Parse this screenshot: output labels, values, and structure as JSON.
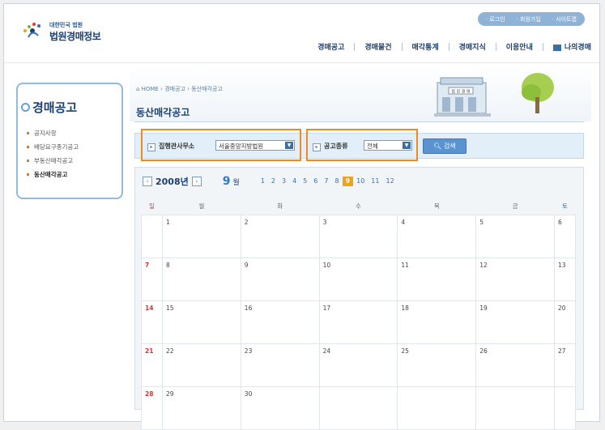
{
  "header": {
    "logo_small": "대한민국 법원",
    "logo_big": "법원경매정보",
    "util_links": [
      "로그인",
      "회원가입",
      "사이트맵"
    ],
    "nav": [
      "경매공고",
      "경매물건",
      "매각통계",
      "경매지식",
      "이용안내",
      "나의경매"
    ]
  },
  "sidebar": {
    "title": "경매공고",
    "items": [
      {
        "label": "공지사항",
        "active": false
      },
      {
        "label": "배당요구종기공고",
        "active": false
      },
      {
        "label": "부동산매각공고",
        "active": false
      },
      {
        "label": "동산매각공고",
        "active": true
      }
    ]
  },
  "breadcrumb": [
    "HOME",
    "경매공고",
    "동산매각공고"
  ],
  "page_title": "동산매각공고",
  "banner": {
    "sign_text": "법 원 경 매"
  },
  "search": {
    "office_label": "집행관사무소",
    "office_value": "서울중앙지방법원",
    "type_label": "공고종류",
    "type_value": "전체",
    "button_label": "검색"
  },
  "calendar": {
    "year": "2008년",
    "month": "9",
    "month_unit": "월",
    "months": [
      "1",
      "2",
      "3",
      "4",
      "5",
      "6",
      "7",
      "8",
      "9",
      "10",
      "11",
      "12"
    ],
    "current_month": "9",
    "weekdays": [
      "일",
      "월",
      "화",
      "수",
      "목",
      "금",
      "토"
    ],
    "weeks": [
      [
        "",
        "1",
        "2",
        "3",
        "4",
        "5",
        "6"
      ],
      [
        "7",
        "8",
        "9",
        "10",
        "11",
        "12",
        "13"
      ],
      [
        "14",
        "15",
        "16",
        "17",
        "18",
        "19",
        "20"
      ],
      [
        "21",
        "22",
        "23",
        "24",
        "25",
        "26",
        "27"
      ],
      [
        "28",
        "29",
        "30",
        "",
        "",
        "",
        ""
      ]
    ]
  },
  "colors": {
    "highlight": "#f08a1e",
    "brand": "#1b3f6e",
    "accent": "#2e79c9"
  }
}
